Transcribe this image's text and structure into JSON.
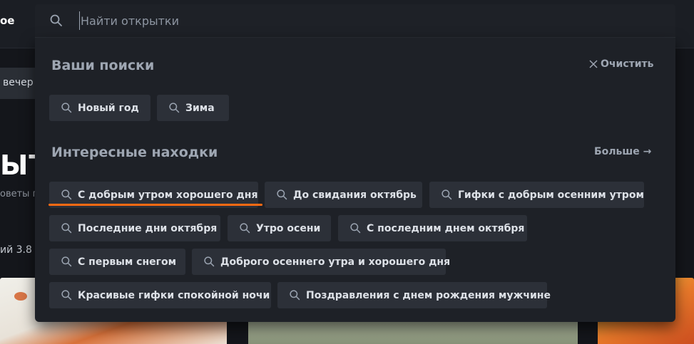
{
  "background": {
    "logo_fragment": "ое",
    "chip_fragment": "вечер",
    "title_fragment": "ЫТІ",
    "subtitle_fragment": "оветы г",
    "rating_fragment": "ий 3.8"
  },
  "search": {
    "placeholder": "Найти открытки",
    "icon": "search-icon"
  },
  "recent": {
    "title": "Ваши поиски",
    "clear_label": "Очистить",
    "clear_icon": "close-icon",
    "items": [
      {
        "label": "Новый год"
      },
      {
        "label": "Зима"
      }
    ]
  },
  "interesting": {
    "title": "Интересные находки",
    "more_label": "Больше →",
    "items": [
      {
        "label": "С добрым утром хорошего дня"
      },
      {
        "label": "До свидания октябрь"
      },
      {
        "label": "Гифки с добрым осенним утром"
      },
      {
        "label": "Последние дни октября"
      },
      {
        "label": "Утро осени"
      },
      {
        "label": "С последним днем октября"
      },
      {
        "label": "С первым снегом"
      },
      {
        "label": "Доброго осеннего утра и хорошего дня"
      },
      {
        "label": "Красивые гифки спокойной ночи"
      },
      {
        "label": "Поздравления с днем рождения мужчине"
      }
    ]
  },
  "colors": {
    "accent": "#ff6a13",
    "panel": "#1e2127",
    "chip": "#2c3038"
  }
}
